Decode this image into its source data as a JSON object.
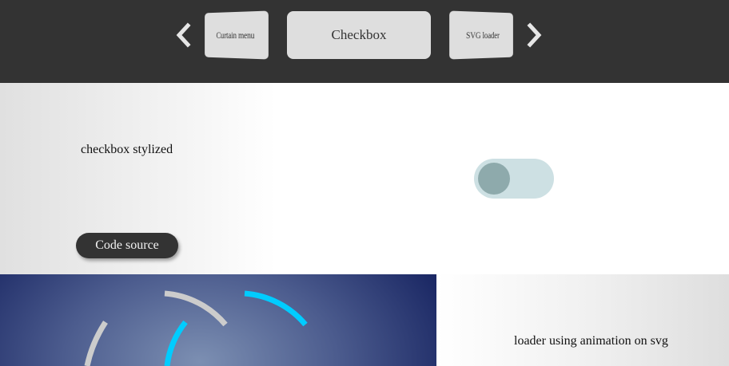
{
  "nav": {
    "prev_label": "",
    "next_label": "",
    "prev_card": "Curtain menu",
    "current_card": "Checkbox",
    "next_card": "SVG loader"
  },
  "checkbox_demo": {
    "title": "checkbox stylized",
    "code_button": "Code source",
    "toggle_checked": false
  },
  "loader_demo": {
    "title": "loader using animation on svg"
  },
  "colors": {
    "topbar": "#333333",
    "card": "#dedede",
    "toggle_track": "#cde0e3",
    "toggle_knob": "#8eaaac",
    "loader_accent": "#00ccff",
    "loader_gray": "#cccccc"
  },
  "icons": {
    "prev": "chevron-left-icon",
    "next": "chevron-right-icon"
  }
}
